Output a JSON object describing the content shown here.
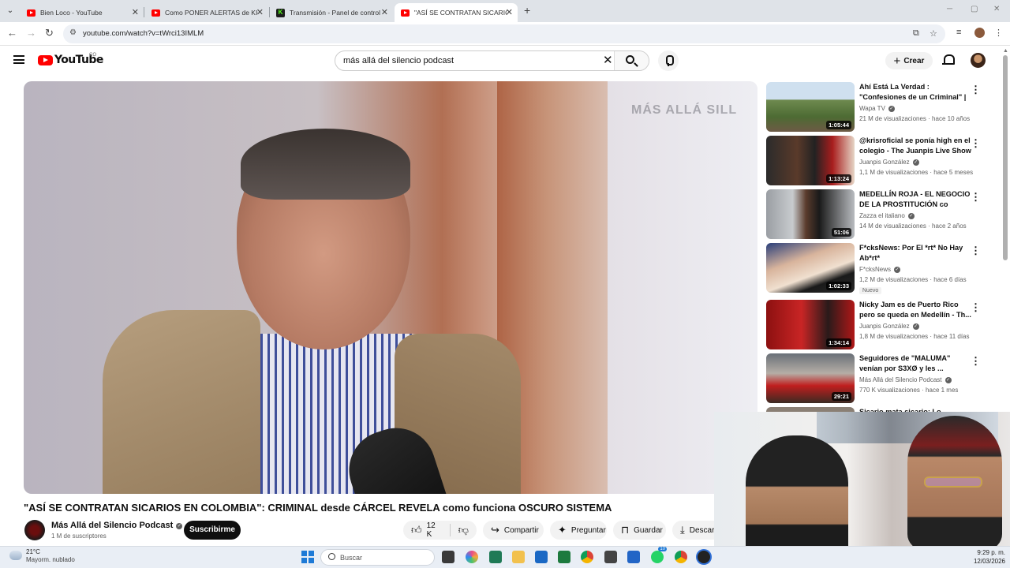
{
  "browser": {
    "tabs": [
      {
        "title": "Bien Loco - YouTube",
        "icon": "youtube-icon",
        "active": false
      },
      {
        "title": "Como PONER ALERTAS de KICK",
        "icon": "youtube-icon",
        "active": false
      },
      {
        "title": "Transmisión - Panel de control",
        "icon": "kick-icon",
        "active": false
      },
      {
        "title": "\"ASÍ SE CONTRATAN SICARIOS",
        "icon": "youtube-icon",
        "active": true
      }
    ],
    "url": "youtube.com/watch?v=tWrci13IMLM"
  },
  "youtube": {
    "logo_text": "YouTube",
    "country_code": "CO",
    "search_query": "más allá del silencio podcast",
    "create_label": "Crear"
  },
  "video": {
    "watermark": "MÁS ALLÁ SILL",
    "title": "\"ASÍ SE CONTRATAN SICARIOS EN COLOMBIA\": CRIMINAL desde CÁRCEL REVELA como funciona OSCURO SISTEMA",
    "channel": "Más Allá del Silencio Podcast",
    "subscribers": "1 M de suscriptores",
    "subscribe_label": "Suscribirme",
    "likes": "12 K",
    "share_label": "Compartir",
    "ask_label": "Preguntar",
    "save_label": "Guardar",
    "download_label": "Descargar"
  },
  "recommendations": [
    {
      "title": "Ahí Está La Verdad : \"Confesiones de un Criminal\" | ...",
      "channel": "Wapa TV",
      "views": "21 M de visualizaciones",
      "age": "hace 10 años",
      "duration": "1:05:44",
      "badge": ""
    },
    {
      "title": "@krisroficial se ponía high en el colegio - The Juanpis Live Show",
      "channel": "Juanpis González",
      "views": "1,1 M de visualizaciones",
      "age": "hace 5 meses",
      "duration": "1:13:24",
      "badge": ""
    },
    {
      "title": "MEDELLÍN ROJA - EL NEGOCIO DE LA PROSTITUCIÓN co",
      "channel": "Zazza el italiano",
      "views": "14 M de visualizaciones",
      "age": "hace 2 años",
      "duration": "51:06",
      "badge": ""
    },
    {
      "title": "F*cksNews: Por El *rt* No Hay Ab*rt*",
      "channel": "F*cksNews",
      "views": "1,2 M de visualizaciones",
      "age": "hace 6 días",
      "duration": "1:02:33",
      "badge": "Nuevo"
    },
    {
      "title": "Nicky Jam es de Puerto Rico pero se queda en Medellín - Th...",
      "channel": "Juanpis González",
      "views": "1,8 M de visualizaciones",
      "age": "hace 11 días",
      "duration": "1:34:14",
      "badge": ""
    },
    {
      "title": "Seguidores de \"MALUMA\" venían por S3XØ y les ...",
      "channel": "Más Allá del Silencio Podcast",
      "views": "770 K visualizaciones",
      "age": "hace 1 mes",
      "duration": "29:21",
      "badge": ""
    },
    {
      "title": "Sicario mata sicario: Lo...",
      "channel": "",
      "views": "",
      "age": "",
      "duration": "",
      "badge": ""
    }
  ],
  "taskbar": {
    "temperature": "21°C",
    "weather": "Mayorm. nublado",
    "search_placeholder": "Buscar",
    "time": "9:29 p. m.",
    "date": "12/03/2026",
    "whatsapp_badge": "10"
  }
}
